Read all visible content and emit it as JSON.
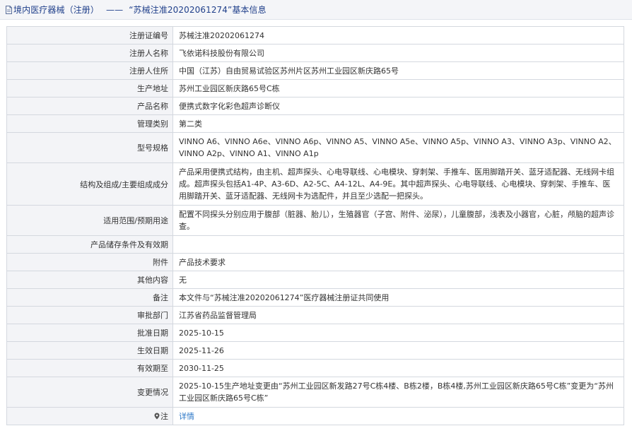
{
  "header": {
    "source": "境内医疗器械（注册）",
    "separator": "——",
    "title": "“苏械注准20202061274”基本信息"
  },
  "rows": [
    {
      "label": "注册证编号",
      "value": "苏械注准20202061274"
    },
    {
      "label": "注册人名称",
      "value": "飞依诺科技股份有限公司"
    },
    {
      "label": "注册人住所",
      "value": "中国（江苏）自由贸易试验区苏州片区苏州工业园区新庆路65号"
    },
    {
      "label": "生产地址",
      "value": "苏州工业园区新庆路65号C栋"
    },
    {
      "label": "产品名称",
      "value": "便携式数字化彩色超声诊断仪"
    },
    {
      "label": "管理类别",
      "value": "第二类"
    },
    {
      "label": "型号规格",
      "value": "VINNO A6、VINNO A6e、VINNO A6p、VINNO A5、VINNO A5e、VINNO A5p、VINNO A3、VINNO A3p、VINNO A2、VINNO A2p、VINNO A1、VINNO A1p"
    },
    {
      "label": "结构及组成/主要组成成分",
      "value": "产品采用便携式结构，由主机、超声探头、心电导联线、心电模块、穿刺架、手推车、医用脚踏开关、蓝牙适配器、无线网卡组成。超声探头包括A1-4P、A3-6D、A2-5C、A4-12L、A4-9E。其中超声探头、心电导联线、心电模块、穿刺架、手推车、医用脚踏开关、蓝牙适配器、无线网卡为选配件，并且至少选配一把探头。"
    },
    {
      "label": "适用范围/预期用途",
      "value": "配置不同探头分别应用于腹部（脏器、胎儿），生殖器官（子宫、附件、泌尿），儿童腹部，浅表及小器官，心脏，颅脑的超声诊查。"
    },
    {
      "label": "产品储存条件及有效期",
      "value": ""
    },
    {
      "label": "附件",
      "value": "产品技术要求"
    },
    {
      "label": "其他内容",
      "value": "无"
    },
    {
      "label": "备注",
      "value": "本文件与“苏械注准20202061274”医疗器械注册证共同使用"
    },
    {
      "label": "审批部门",
      "value": "江苏省药品监督管理局"
    },
    {
      "label": "批准日期",
      "value": "2025-10-15"
    },
    {
      "label": "生效日期",
      "value": "2025-11-26"
    },
    {
      "label": "有效期至",
      "value": "2030-11-25"
    },
    {
      "label": "变更情况",
      "value": "2025-10-15生产地址变更由“苏州工业园区新发路27号C栋4楼、B栋2楼，B栋4楼,苏州工业园区新庆路65号C栋”变更为“苏州工业园区新庆路65号C栋”"
    }
  ],
  "note_row": {
    "icon": "pin-icon",
    "label": "注",
    "link": "详情"
  },
  "colors": {
    "header_bg": "#f4f5f8",
    "header_text": "#1f3f8a",
    "label_bg": "#f3f4f7",
    "border": "#d4d8df",
    "link": "#2d78c8"
  }
}
